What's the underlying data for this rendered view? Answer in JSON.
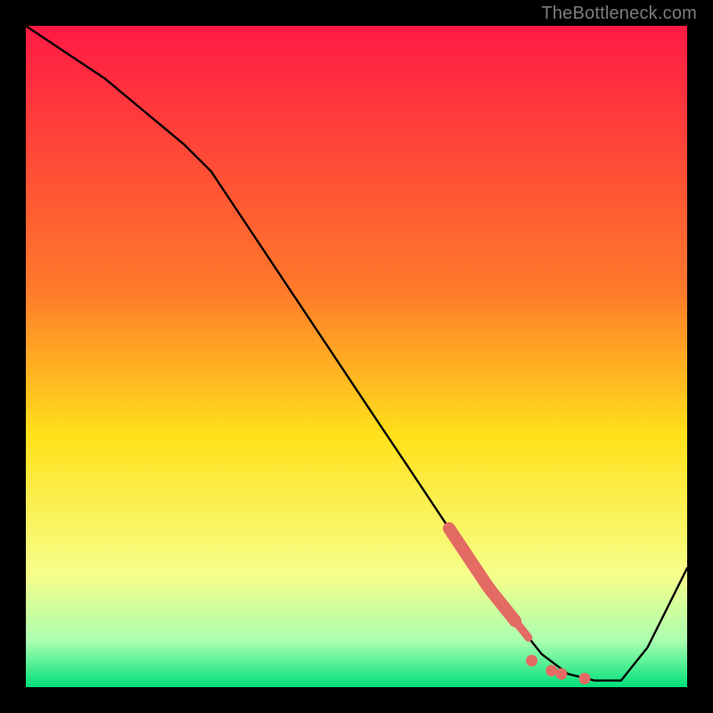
{
  "watermark": "TheBottleneck.com",
  "colors": {
    "frame": "#000000",
    "watermark": "#7b7b7b",
    "curve": "#000000",
    "points": "#e46a64",
    "gradient_top": "#ff1a44",
    "gradient_mid1": "#ff7a2a",
    "gradient_mid2": "#ffe11a",
    "gradient_low1": "#f6ff8a",
    "gradient_low2": "#aaffb0",
    "gradient_bottom": "#00e07a"
  },
  "chart_data": {
    "type": "line",
    "title": "",
    "xlabel": "",
    "ylabel": "",
    "xlim": [
      0,
      100
    ],
    "ylim": [
      0,
      100
    ],
    "series": [
      {
        "name": "bottleneck-curve",
        "x": [
          0,
          6,
          12,
          18,
          24,
          28,
          34,
          40,
          46,
          52,
          58,
          64,
          70,
          74,
          78,
          82,
          86,
          90,
          94,
          100
        ],
        "y": [
          100,
          96,
          92,
          87,
          82,
          78,
          69,
          60,
          51,
          42,
          33,
          24,
          15,
          10,
          5,
          2,
          1,
          1,
          6,
          18
        ]
      }
    ],
    "highlight_points": {
      "name": "highlight-cluster",
      "segment": {
        "x_start": 64,
        "x_end": 74,
        "thick": true
      },
      "dots": [
        {
          "x": 76.5,
          "y": 4.0
        },
        {
          "x": 79.5,
          "y": 2.5
        },
        {
          "x": 81.0,
          "y": 2.0
        },
        {
          "x": 84.5,
          "y": 1.3
        }
      ]
    }
  }
}
